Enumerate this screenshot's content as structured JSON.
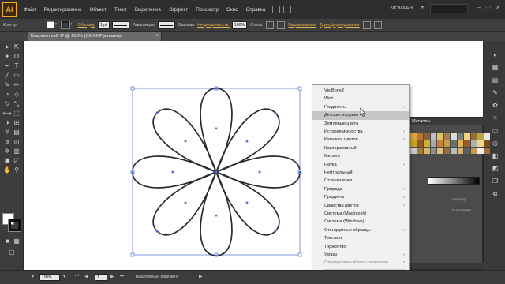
{
  "app": {
    "logo_text": "Ai",
    "workspace": "МСМААЯ"
  },
  "menubar": {
    "items": [
      "Файл",
      "Редактирование",
      "Объект",
      "Текст",
      "Выделение",
      "Эффект",
      "Просмотр",
      "Окно",
      "Справка"
    ]
  },
  "controlbar": {
    "mode_label": "Контур",
    "stroke_link": "Обводка:",
    "stroke_weight": "1 pt",
    "profile": "Равномерно",
    "brush": "Базовая",
    "opacity_link": "Непрозрачность:",
    "opacity_value": "100%",
    "style_label": "Стиль:",
    "align_link": "Выравнивание",
    "transform_link": "Трансформирование"
  },
  "document": {
    "tab_title": "Безымянный-1* @ 100% (CMYK/Просмотр)",
    "close_glyph": "×"
  },
  "context_menu": {
    "items": [
      {
        "label": "VisiBone2",
        "submenu": false,
        "highlight": false,
        "disabled": false
      },
      {
        "label": "Web",
        "submenu": false,
        "highlight": false,
        "disabled": false
      },
      {
        "label": "Градиенты",
        "submenu": true,
        "highlight": false,
        "disabled": false
      },
      {
        "label": "Детские игрушки",
        "submenu": false,
        "highlight": true,
        "disabled": false
      },
      {
        "label": "Земляные цвета",
        "submenu": false,
        "highlight": false,
        "disabled": false
      },
      {
        "label": "История искусства",
        "submenu": true,
        "highlight": false,
        "disabled": false
      },
      {
        "label": "Каталоги цветов",
        "submenu": true,
        "highlight": false,
        "disabled": false
      },
      {
        "label": "Корпоративный",
        "submenu": false,
        "highlight": false,
        "disabled": false
      },
      {
        "label": "Металл",
        "submenu": false,
        "highlight": false,
        "disabled": false
      },
      {
        "label": "Наука",
        "submenu": true,
        "highlight": false,
        "disabled": false
      },
      {
        "label": "Нейтральный",
        "submenu": false,
        "highlight": false,
        "disabled": false
      },
      {
        "label": "Оттенки кожи",
        "submenu": false,
        "highlight": false,
        "disabled": false
      },
      {
        "label": "Природа",
        "submenu": true,
        "highlight": false,
        "disabled": false
      },
      {
        "label": "Продукты",
        "submenu": true,
        "highlight": false,
        "disabled": false
      },
      {
        "label": "Свойства цветов",
        "submenu": true,
        "highlight": false,
        "disabled": false
      },
      {
        "label": "Система (Macintosh)",
        "submenu": false,
        "highlight": false,
        "disabled": false
      },
      {
        "label": "Система (Windows)",
        "submenu": false,
        "highlight": false,
        "disabled": false
      },
      {
        "label": "Стандартные образцы",
        "submenu": true,
        "highlight": false,
        "disabled": false
      },
      {
        "label": "Текстиль",
        "submenu": false,
        "highlight": false,
        "disabled": false
      },
      {
        "label": "Торжество",
        "submenu": false,
        "highlight": false,
        "disabled": false
      },
      {
        "label": "Узоры",
        "submenu": true,
        "highlight": false,
        "disabled": false
      },
      {
        "label": "Определяемый пользователем",
        "submenu": true,
        "highlight": false,
        "disabled": true
      },
      {
        "label": "Другая библиотека...",
        "submenu": false,
        "highlight": false,
        "disabled": false
      }
    ],
    "submenu_glyph": "›"
  },
  "swatch_panel": {
    "title": "Металлы",
    "swatches": [
      "#d9a441",
      "#b87333",
      "#8c6239",
      "#c0c0c0",
      "#e6c35c",
      "#a67c52",
      "#dcdcdc",
      "#7f7f7f",
      "#f2d17a",
      "#9c6b30",
      "#b5a642",
      "#e8e8e8",
      "#c9a227",
      "#8a5a2b",
      "#d4af37",
      "#a8a8a8",
      "#cd7f32",
      "#bfa14a",
      "#6e6e6e",
      "#e0b352",
      "#995c2e",
      "#b0b0b0",
      "#f0d58c",
      "#7a4e22",
      "#c8c8c8",
      "#a47a3c",
      "#d8b463",
      "#909090",
      "#e5c07b",
      "#8b6f47",
      "#bcbcbc",
      "#d9b26f",
      "#5f5f5f",
      "#c79a4a",
      "#eeeeee",
      "#a0713a"
    ],
    "row1_label": "Непрозр.:",
    "row2_label": "Положение:"
  },
  "statusbar": {
    "zoom": "100%",
    "page": "1",
    "status": "Выделенный фрагмент"
  },
  "colors": {
    "accent": "#f7a823",
    "selection": "#4a6fd1",
    "menu_bg": "#f0f0f0",
    "menu_highlight": "#c6c6c6"
  },
  "icons": {
    "toolbar": [
      "selection-tool-icon",
      "direct-selection-tool-icon",
      "magic-wand-tool-icon",
      "lasso-tool-icon",
      "pen-tool-icon",
      "type-tool-icon",
      "line-tool-icon",
      "rectangle-tool-icon",
      "paintbrush-tool-icon",
      "pencil-tool-icon",
      "blob-brush-tool-icon",
      "eraser-tool-icon",
      "rotate-tool-icon",
      "scale-tool-icon",
      "width-tool-icon",
      "free-transform-tool-icon",
      "shape-builder-tool-icon",
      "perspective-grid-tool-icon",
      "mesh-tool-icon",
      "gradient-tool-icon",
      "eyedropper-tool-icon",
      "blend-tool-icon",
      "symbol-sprayer-tool-icon",
      "column-graph-tool-icon",
      "artboard-tool-icon",
      "slice-tool-icon",
      "hand-tool-icon",
      "zoom-tool-icon"
    ],
    "dock": [
      "color-panel-icon",
      "color-guide-icon",
      "swatches-panel-icon",
      "brushes-panel-icon",
      "symbols-panel-icon",
      "stroke-panel-icon",
      "gradient-panel-icon",
      "transparency-panel-icon",
      "appearance-panel-icon",
      "graphic-styles-panel-icon",
      "layers-panel-icon",
      "artboards-panel-icon"
    ]
  }
}
